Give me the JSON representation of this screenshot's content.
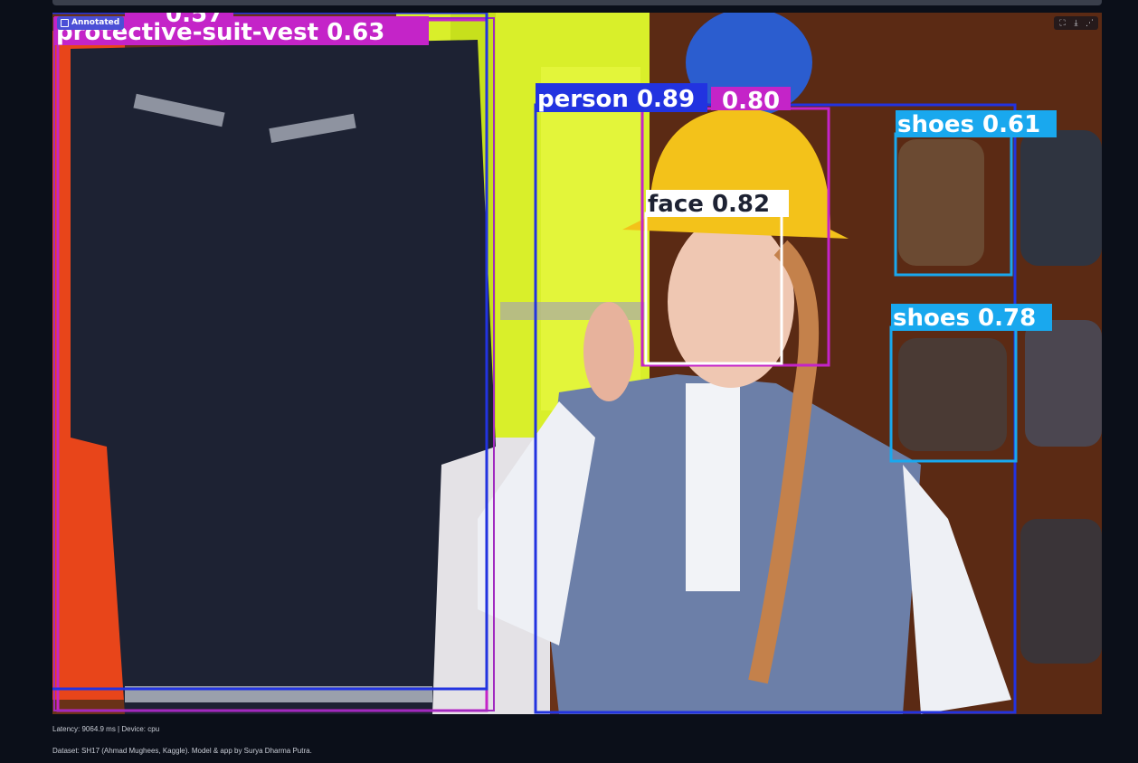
{
  "image": {
    "badge_label": "Annotated",
    "toolbar": {
      "fullscreen": "fullscreen-icon",
      "download": "download-icon",
      "share": "share-icon"
    },
    "detections": {
      "vest_partial": "0.57",
      "protective_suit": "protective-suit-vest 0.63",
      "person": "person 0.89",
      "helmet_partial": "0.80",
      "face": "face 0.82",
      "shoes_top": "shoes 0.61",
      "shoes_bottom": "shoes 0.78"
    },
    "colors": {
      "suit_box": "#c424c8",
      "person_box": "#2233e0",
      "face_box": "#ffffff",
      "shoes_box": "#19a8ee"
    }
  },
  "footer": {
    "latency": "Latency: 9064.9 ms | Device: cpu",
    "credits": "Dataset: SH17 (Ahmad Mughees, Kaggle). Model & app by Surya Dharma Putra."
  }
}
